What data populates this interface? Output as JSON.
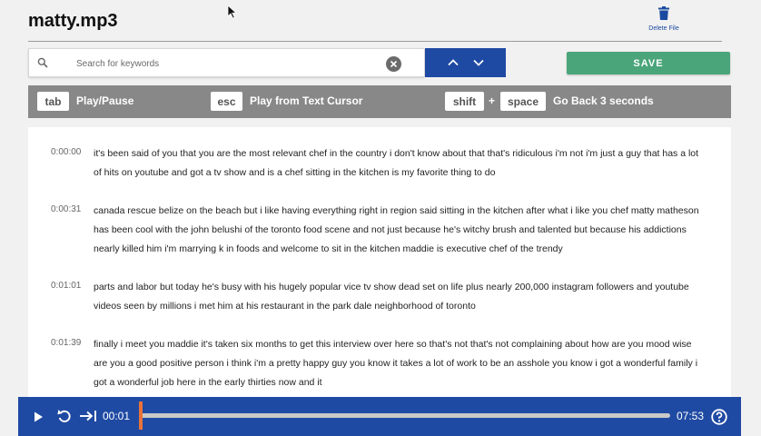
{
  "file": {
    "name": "matty.mp3",
    "delete_label": "Delete File"
  },
  "search": {
    "placeholder": "Search for keywords",
    "value": ""
  },
  "toolbar": {
    "save_label": "SAVE"
  },
  "shortcuts": [
    {
      "key": "tab",
      "action": "Play/Pause"
    },
    {
      "key": "esc",
      "action": "Play from Text Cursor"
    },
    {
      "keys": [
        "shift",
        "space"
      ],
      "plus": "+",
      "action": "Go Back 3 seconds"
    }
  ],
  "transcript": [
    {
      "time": "0:00:00",
      "text": "it's been said of you that you are the most relevant chef in the country i don't know about that that's ridiculous i'm not i'm just a guy that has a lot of hits on youtube and got a tv show and is a chef sitting in the kitchen is my favorite thing to do"
    },
    {
      "time": "0:00:31",
      "text": "canada rescue belize on the beach but i like having everything right in region said sitting in the kitchen after what i like you chef matty matheson has been cool with the john belushi of the toronto food scene and not just because he's witchy brush and talented but because his addictions nearly killed him i'm marrying k in foods and welcome to sit in the kitchen maddie is executive chef of the trendy"
    },
    {
      "time": "0:01:01",
      "text": "parts and labor but today he's busy with his hugely popular vice tv show dead set on life plus nearly 200,000 instagram followers and youtube videos seen by millions i met him at his restaurant in the park dale neighborhood of toronto"
    },
    {
      "time": "0:01:39",
      "text": "finally i meet you maddie it's taken six months to get this interview over here so that's not that's not complaining about how are you mood wise are you a good positive person i think i'm a pretty happy guy you know it takes a lot of work to be an asshole you know i got a wonderful family i got a wonderful job here in the early thirties now and it"
    }
  ],
  "player": {
    "current_time": "00:01",
    "total_time": "07:53",
    "progress_fraction": 0.002
  },
  "colors": {
    "accent_blue": "#1f4aa3",
    "save_green": "#4aa57a",
    "progress_orange": "#e8733a",
    "shortcut_bar": "#888888"
  },
  "icons": [
    "cursor-icon",
    "trash-icon",
    "search-icon",
    "close-icon",
    "chevron-up-icon",
    "chevron-down-icon",
    "play-icon",
    "replay-icon",
    "skip-to-end-icon",
    "help-icon"
  ]
}
